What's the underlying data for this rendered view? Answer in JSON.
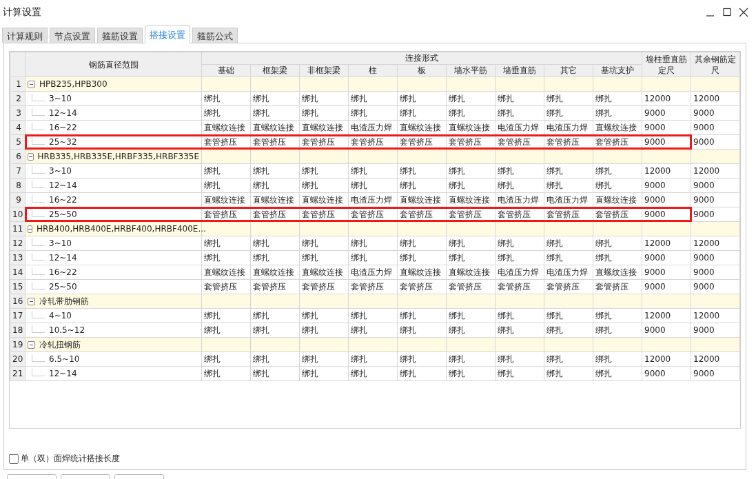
{
  "window": {
    "title": "计算设置"
  },
  "tabs": [
    {
      "label": "计算规则",
      "selected": false
    },
    {
      "label": "节点设置",
      "selected": false
    },
    {
      "label": "箍筋设置",
      "selected": false
    },
    {
      "label": "搭接设置",
      "selected": true
    },
    {
      "label": "箍筋公式",
      "selected": false
    }
  ],
  "table": {
    "range_header": "钢筋直径范围",
    "group_header": "连接形式",
    "columns": [
      "基础",
      "框架梁",
      "非框架梁",
      "柱",
      "板",
      "墙水平筋",
      "墙垂直筋",
      "其它",
      "基坑支护"
    ],
    "extra_columns": [
      "墙柱垂直筋定尺",
      "其余钢筋定尺"
    ],
    "groups": [
      {
        "number": "1",
        "label": "HPB235,HPB300",
        "expanded": true,
        "children": [
          {
            "number": "2",
            "range": "3~10",
            "cells": [
              "绑扎",
              "绑扎",
              "绑扎",
              "绑扎",
              "绑扎",
              "绑扎",
              "绑扎",
              "绑扎",
              "绑扎",
              "12000",
              "12000"
            ],
            "highlighted": false
          },
          {
            "number": "3",
            "range": "12~14",
            "cells": [
              "绑扎",
              "绑扎",
              "绑扎",
              "绑扎",
              "绑扎",
              "绑扎",
              "绑扎",
              "绑扎",
              "绑扎",
              "9000",
              "9000"
            ],
            "highlighted": false
          },
          {
            "number": "4",
            "range": "16~22",
            "cells": [
              "直螺纹连接",
              "直螺纹连接",
              "直螺纹连接",
              "电渣压力焊",
              "直螺纹连接",
              "直螺纹连接",
              "电渣压力焊",
              "电渣压力焊",
              "直螺纹连接",
              "9000",
              "9000"
            ],
            "highlighted": false
          },
          {
            "number": "5",
            "range": "25~32",
            "cells": [
              "套管挤压",
              "套管挤压",
              "套管挤压",
              "套管挤压",
              "套管挤压",
              "套管挤压",
              "套管挤压",
              "套管挤压",
              "套管挤压",
              "9000",
              "9000"
            ],
            "highlighted": true
          }
        ]
      },
      {
        "number": "6",
        "label": "HRB335,HRB335E,HRBF335,HRBF335E",
        "expanded": true,
        "children": [
          {
            "number": "7",
            "range": "3~10",
            "cells": [
              "绑扎",
              "绑扎",
              "绑扎",
              "绑扎",
              "绑扎",
              "绑扎",
              "绑扎",
              "绑扎",
              "绑扎",
              "12000",
              "12000"
            ],
            "highlighted": false
          },
          {
            "number": "8",
            "range": "12~14",
            "cells": [
              "绑扎",
              "绑扎",
              "绑扎",
              "绑扎",
              "绑扎",
              "绑扎",
              "绑扎",
              "绑扎",
              "绑扎",
              "9000",
              "9000"
            ],
            "highlighted": false
          },
          {
            "number": "9",
            "range": "16~22",
            "cells": [
              "直螺纹连接",
              "直螺纹连接",
              "直螺纹连接",
              "电渣压力焊",
              "直螺纹连接",
              "直螺纹连接",
              "电渣压力焊",
              "电渣压力焊",
              "直螺纹连接",
              "9000",
              "9000"
            ],
            "highlighted": false
          },
          {
            "number": "10",
            "range": "25~50",
            "cells": [
              "套管挤压",
              "套管挤压",
              "套管挤压",
              "套管挤压",
              "套管挤压",
              "套管挤压",
              "套管挤压",
              "套管挤压",
              "套管挤压",
              "9000",
              "9000"
            ],
            "highlighted": true
          }
        ]
      },
      {
        "number": "11",
        "label": "HRB400,HRB400E,HRBF400,HRBF400E...",
        "expanded": true,
        "children": [
          {
            "number": "12",
            "range": "3~10",
            "cells": [
              "绑扎",
              "绑扎",
              "绑扎",
              "绑扎",
              "绑扎",
              "绑扎",
              "绑扎",
              "绑扎",
              "绑扎",
              "12000",
              "12000"
            ],
            "highlighted": false
          },
          {
            "number": "13",
            "range": "12~14",
            "cells": [
              "绑扎",
              "绑扎",
              "绑扎",
              "绑扎",
              "绑扎",
              "绑扎",
              "绑扎",
              "绑扎",
              "绑扎",
              "9000",
              "9000"
            ],
            "highlighted": false
          },
          {
            "number": "14",
            "range": "16~22",
            "cells": [
              "直螺纹连接",
              "直螺纹连接",
              "直螺纹连接",
              "电渣压力焊",
              "直螺纹连接",
              "直螺纹连接",
              "电渣压力焊",
              "电渣压力焊",
              "直螺纹连接",
              "9000",
              "9000"
            ],
            "highlighted": false
          },
          {
            "number": "15",
            "range": "25~50",
            "cells": [
              "套管挤压",
              "套管挤压",
              "套管挤压",
              "套管挤压",
              "套管挤压",
              "套管挤压",
              "套管挤压",
              "套管挤压",
              "套管挤压",
              "9000",
              "9000"
            ],
            "highlighted": false
          }
        ]
      },
      {
        "number": "16",
        "label": "冷轧带肋钢筋",
        "expanded": true,
        "children": [
          {
            "number": "17",
            "range": "4~10",
            "cells": [
              "绑扎",
              "绑扎",
              "绑扎",
              "绑扎",
              "绑扎",
              "绑扎",
              "绑扎",
              "绑扎",
              "绑扎",
              "12000",
              "12000"
            ],
            "highlighted": false
          },
          {
            "number": "18",
            "range": "10.5~12",
            "cells": [
              "绑扎",
              "绑扎",
              "绑扎",
              "绑扎",
              "绑扎",
              "绑扎",
              "绑扎",
              "绑扎",
              "绑扎",
              "9000",
              "9000"
            ],
            "highlighted": false
          }
        ]
      },
      {
        "number": "19",
        "label": "冷轧扭钢筋",
        "expanded": true,
        "children": [
          {
            "number": "20",
            "range": "6.5~10",
            "cells": [
              "绑扎",
              "绑扎",
              "绑扎",
              "绑扎",
              "绑扎",
              "绑扎",
              "绑扎",
              "绑扎",
              "绑扎",
              "12000",
              "12000"
            ],
            "highlighted": false
          },
          {
            "number": "21",
            "range": "12~14",
            "cells": [
              "绑扎",
              "绑扎",
              "绑扎",
              "绑扎",
              "绑扎",
              "绑扎",
              "绑扎",
              "绑扎",
              "绑扎",
              "9000",
              "9000"
            ],
            "highlighted": false
          }
        ]
      }
    ]
  },
  "option": {
    "label": "单（双）面焊统计搭接长度",
    "checked": false
  }
}
